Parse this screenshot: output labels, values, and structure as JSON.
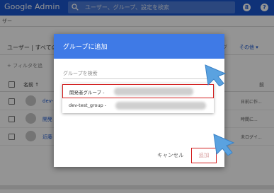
{
  "app": {
    "logo_text": "Google Admin",
    "search_placeholder": "ユーザー、グループ、設定を検索",
    "help_icon_glyph": "?",
    "notifications_icon_glyph": "8"
  },
  "breadcrumb": "ザー",
  "background": {
    "header_title": "ユーザー | すべての",
    "header_fragment": "グ",
    "header_other": "その他 ▾",
    "filter_text": "+ フィルタを追",
    "table_header_name": "名前 ↑",
    "table_header_right": "前",
    "rows": [
      {
        "name": "dev-",
        "right": "日前に作..."
      },
      {
        "name": "開発",
        "right": "時間に..."
      },
      {
        "name": "近藤",
        "right": "未ログイ..."
      }
    ]
  },
  "dialog": {
    "title": "グループに追加",
    "search_label": "グループを検索",
    "options": [
      {
        "label": "開発者グループ -",
        "selected": true
      },
      {
        "label": "dev-test_group -",
        "selected": false
      }
    ],
    "cancel_label": "キャンセル",
    "add_label": "追加"
  },
  "colors": {
    "topbar": "#1a56cf",
    "dialog_header": "#3f7ae6",
    "highlight": "#d32020",
    "pointer_arrow": "#5aa2e0"
  },
  "icons": [
    "search-icon",
    "notifications-icon",
    "help-icon",
    "pointer-arrow-icon"
  ]
}
